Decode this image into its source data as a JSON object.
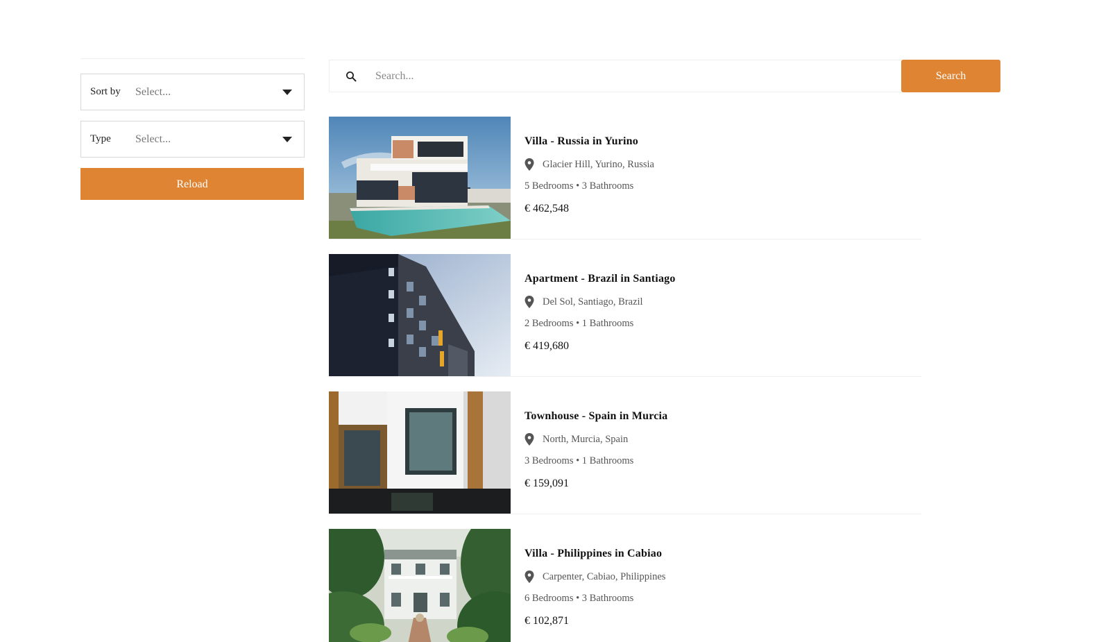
{
  "filters": {
    "sort": {
      "label": "Sort by",
      "value": "Select..."
    },
    "type": {
      "label": "Type",
      "value": "Select..."
    },
    "reload_label": "Reload"
  },
  "search": {
    "placeholder": "Search...",
    "button_label": "Search"
  },
  "colors": {
    "accent": "#de8433"
  },
  "listings": [
    {
      "title": "Villa - Russia in Yurino",
      "location": "Glacier Hill, Yurino, Russia",
      "rooms": "5 Bedrooms • 3 Bathrooms",
      "price": "€ 462,548"
    },
    {
      "title": "Apartment - Brazil in Santiago",
      "location": "Del Sol, Santiago, Brazil",
      "rooms": "2 Bedrooms • 1 Bathrooms",
      "price": "€ 419,680"
    },
    {
      "title": "Townhouse - Spain in Murcia",
      "location": "North, Murcia, Spain",
      "rooms": "3 Bedrooms • 1 Bathrooms",
      "price": "€ 159,091"
    },
    {
      "title": "Villa - Philippines in Cabiao",
      "location": "Carpenter, Cabiao, Philippines",
      "rooms": "6 Bedrooms • 3 Bathrooms",
      "price": "€ 102,871"
    }
  ]
}
